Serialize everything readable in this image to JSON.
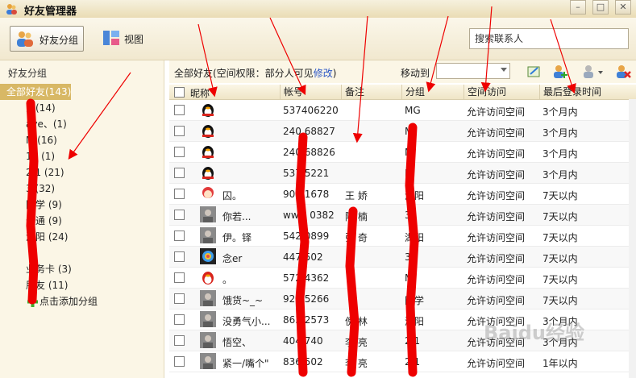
{
  "window": {
    "title": "好友管理器"
  },
  "toolbar": {
    "group_button": "好友分组",
    "view_button": "视图",
    "search_placeholder": "搜索联系人"
  },
  "sidebar": {
    "header": "好友分组",
    "groups": [
      {
        "label": "全部好友(143)",
        "selected": true
      },
      {
        "label": "家(14)"
      },
      {
        "label": "ave、(1)"
      },
      {
        "label": "M (16)"
      },
      {
        "label": "13 (1)"
      },
      {
        "label": "2 1 (21)"
      },
      {
        "label": "3 (32)"
      },
      {
        "label": "同学 (9)"
      },
      {
        "label": "普通 (9)"
      },
      {
        "label": "湖阳 (24)"
      },
      {
        "label": "业务卡 (3)"
      },
      {
        "label": "朋友 (11)"
      }
    ],
    "add_group": "点击添加分组"
  },
  "main": {
    "permission_prefix": "全部好友(空间权限：部分人可见",
    "permission_link": "修改",
    "permission_suffix": ")",
    "moveto_label": "移动到",
    "columns": {
      "nick": "昵称",
      "account": "帐号",
      "note": "备注",
      "group": "分组",
      "space": "空间访问",
      "last_login": "最后登录时间"
    },
    "rows": [
      {
        "avatar": "qq-penguin",
        "nick": "",
        "account": "537406220",
        "note": "",
        "group": "MG",
        "space": "允许访问空间",
        "last": "3个月内"
      },
      {
        "avatar": "qq-penguin",
        "nick": "",
        "account": "240 68827",
        "note": "",
        "group": "M",
        "space": "允许访问空间",
        "last": "3个月内"
      },
      {
        "avatar": "qq-penguin",
        "nick": "",
        "account": "240 68826",
        "note": "",
        "group": "M",
        "space": "允许访问空间",
        "last": "3个月内"
      },
      {
        "avatar": "qq-penguin",
        "nick": "",
        "account": "537 5221",
        "note": "",
        "group": "M",
        "space": "允许访问空间",
        "last": "3个月内"
      },
      {
        "avatar": "cartoon-girl",
        "nick": "囚。",
        "account": "905 1678",
        "note": "王 娇",
        "group": "湖阳",
        "space": "允许访问空间",
        "last": "7天以内"
      },
      {
        "avatar": "photo",
        "nick": "你若...",
        "account": "www 0382",
        "note": "陈 楠",
        "group": "3",
        "space": "允许访问空间",
        "last": "7天以内"
      },
      {
        "avatar": "photo",
        "nick": "伊。铎",
        "account": "542 0899",
        "note": "张 奇",
        "group": "湖阳",
        "space": "允许访问空间",
        "last": "7天以内"
      },
      {
        "avatar": "colorful",
        "nick": "念er",
        "account": "447 502",
        "note": "",
        "group": "3",
        "space": "允许访问空间",
        "last": "7天以内"
      },
      {
        "avatar": "qq-red",
        "nick": "。",
        "account": "572 4362",
        "note": "",
        "group": "M",
        "space": "允许访问空间",
        "last": "7天以内"
      },
      {
        "avatar": "photo",
        "nick": "饿货~_~",
        "account": "920 5266",
        "note": "",
        "group": "同学",
        "space": "允许访问空间",
        "last": "7天以内"
      },
      {
        "avatar": "photo",
        "nick": "没勇气小...",
        "account": "863 2573",
        "note": "倪 林",
        "group": "湖阳",
        "space": "允许访问空间",
        "last": "3个月内"
      },
      {
        "avatar": "photo",
        "nick": "悟空、",
        "account": "404 740",
        "note": "李 亮",
        "group": "2 1",
        "space": "允许访问空间",
        "last": "3个月内"
      },
      {
        "avatar": "photo",
        "nick": "紧一/嘴个\"",
        "account": "836 502",
        "note": "李 亮",
        "group": "2 1",
        "space": "允许访问空间",
        "last": "1年以内"
      }
    ]
  },
  "watermark": "Baidu经验",
  "colors": {
    "accent": "#d8b865",
    "annotation": "#ee0000",
    "link": "#2a56c6"
  },
  "icons": {
    "app": "user-manager-icon",
    "group_button": "users-icon",
    "view_button": "view-icon",
    "add": "plus-icon"
  }
}
